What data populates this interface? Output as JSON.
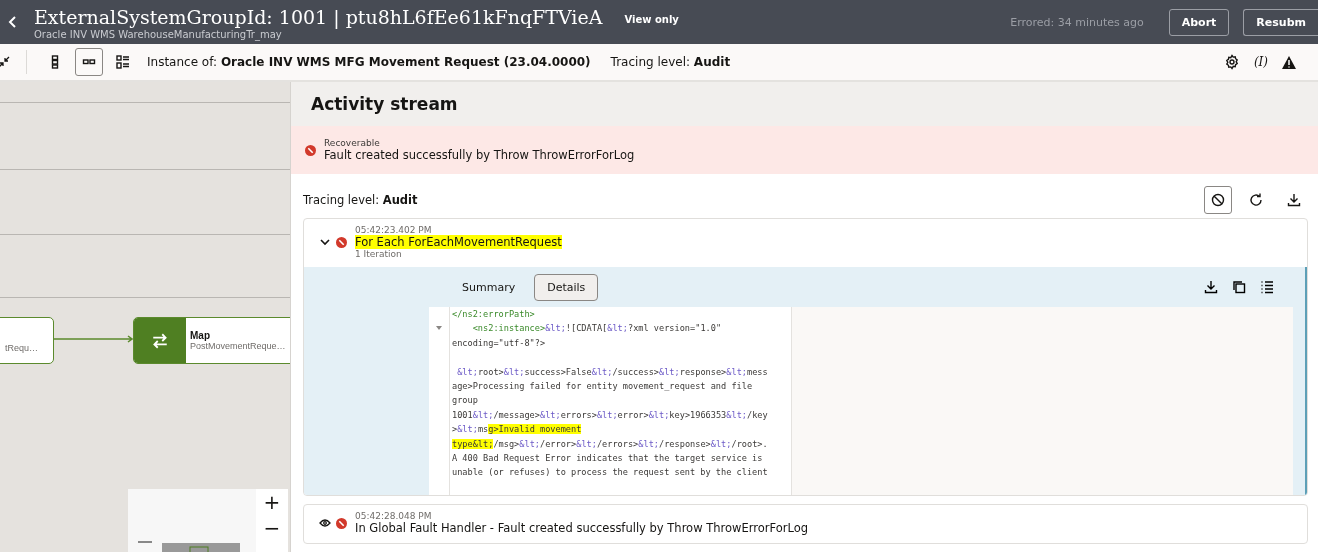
{
  "header": {
    "title": "ExternalSystemGroupId: 1001 | ptu8hL6fEe61kFnqFTVieA",
    "subtitle": "Oracle INV WMS WarehouseManufacturingTr_may",
    "badge": "View only",
    "status": "Errored: 34 minutes ago",
    "buttons": [
      "Abort",
      "Resubm"
    ]
  },
  "toolbar": {
    "views": [
      {
        "selected": false
      },
      {
        "selected": true
      },
      {
        "selected": false
      }
    ],
    "instance_label": "Instance of:",
    "instance_value": "Oracle INV WMS MFG Movement Request (23.04.0000)",
    "tracing_label": "Tracing level:",
    "tracing_value": "Audit",
    "variable_icon": "(I)"
  },
  "canvas": {
    "nodes": [
      {
        "kind": "partial",
        "subtitle": "tRequ…"
      },
      {
        "kind": "map",
        "title": "Map",
        "subtitle": "PostMovementReque…"
      }
    ],
    "zoom": [
      "+",
      "−"
    ]
  },
  "activity": {
    "title": "Activity stream",
    "alert": {
      "label": "Recoverable",
      "message": "Fault created successfully by Throw ThrowErrorForLog"
    },
    "tracing_label": "Tracing level:",
    "tracing_value": "Audit",
    "entries": [
      {
        "time": "05:42:23.402 PM",
        "title": "For Each ForEachMovementRequest",
        "highlighted": true,
        "sub": "1 Iteration",
        "expanded": true,
        "tabs": [
          {
            "label": "Summary",
            "selected": false
          },
          {
            "label": "Details",
            "selected": true
          }
        ],
        "code": [
          [
            {
              "text": "</ns2:errorPath>",
              "kind": "tag"
            }
          ],
          [
            {
              "text": "    <ns2:instance>",
              "kind": "tag"
            },
            {
              "text": "&lt;",
              "kind": "entity"
            },
            {
              "text": "![CDATA[",
              "kind": "plain"
            },
            {
              "text": "&lt;",
              "kind": "entity"
            },
            {
              "text": "?xml version=\"1.0\"",
              "kind": "plain"
            }
          ],
          [
            {
              "text": "encoding=\"utf-8\"?>",
              "kind": "plain"
            }
          ],
          {
            "gap_before": true,
            "segs": [
              {
                "text": " &lt;",
                "kind": "entity"
              },
              {
                "text": "root>",
                "kind": "plain"
              },
              {
                "text": "&lt;",
                "kind": "entity"
              },
              {
                "text": "success>False",
                "kind": "plain"
              },
              {
                "text": "&lt;",
                "kind": "entity"
              },
              {
                "text": "/success>",
                "kind": "plain"
              },
              {
                "text": "&lt;",
                "kind": "entity"
              },
              {
                "text": "response>",
                "kind": "plain"
              },
              {
                "text": "&lt;",
                "kind": "entity"
              },
              {
                "text": "mess",
                "kind": "plain"
              }
            ]
          },
          [
            {
              "text": "age>Processing failed for entity movement_request and file",
              "kind": "plain"
            }
          ],
          [
            {
              "text": "group",
              "kind": "plain"
            }
          ],
          [
            {
              "text": "1001",
              "kind": "plain"
            },
            {
              "text": "&lt;",
              "kind": "entity"
            },
            {
              "text": "/message>",
              "kind": "plain"
            },
            {
              "text": "&lt;",
              "kind": "entity"
            },
            {
              "text": "errors>",
              "kind": "plain"
            },
            {
              "text": "&lt;",
              "kind": "entity"
            },
            {
              "text": "error>",
              "kind": "plain"
            },
            {
              "text": "&lt;",
              "kind": "entity"
            },
            {
              "text": "key>1966353",
              "kind": "plain"
            },
            {
              "text": "&lt;",
              "kind": "entity"
            },
            {
              "text": "/key",
              "kind": "plain"
            }
          ],
          [
            {
              "text": ">",
              "kind": "plain"
            },
            {
              "text": "&lt;",
              "kind": "entity"
            },
            {
              "text": "ms",
              "kind": "plain"
            },
            {
              "text": "g>Invalid movement",
              "kind": "mark"
            }
          ],
          [
            {
              "text": "type&lt;",
              "kind": "mark"
            },
            {
              "text": "/msg>",
              "kind": "plain"
            },
            {
              "text": "&lt;",
              "kind": "entity"
            },
            {
              "text": "/error>",
              "kind": "plain"
            },
            {
              "text": "&lt;",
              "kind": "entity"
            },
            {
              "text": "/errors>",
              "kind": "plain"
            },
            {
              "text": "&lt;",
              "kind": "entity"
            },
            {
              "text": "/response>",
              "kind": "plain"
            },
            {
              "text": "&lt;",
              "kind": "entity"
            },
            {
              "text": "/root>.",
              "kind": "plain"
            }
          ],
          [
            {
              "text": "A 400 Bad Request Error indicates that the target service is",
              "kind": "plain"
            }
          ],
          [
            {
              "text": "unable (or refuses) to process the request sent by the client",
              "kind": "plain"
            }
          ]
        ]
      },
      {
        "time": "05:42:28.048 PM",
        "title": "In Global Fault Handler - Fault created successfully by Throw ThrowErrorForLog",
        "highlighted": false,
        "expanded": false
      }
    ]
  }
}
